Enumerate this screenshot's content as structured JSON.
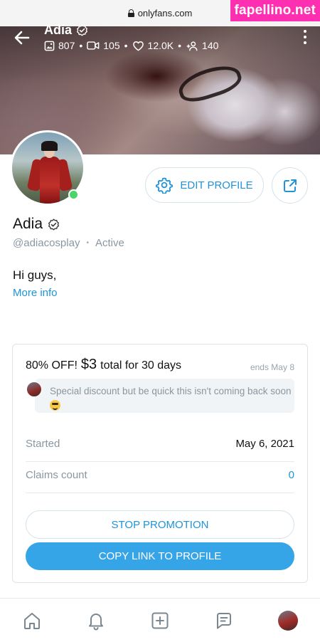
{
  "browser": {
    "url": "onlyfans.com"
  },
  "watermark": "fapellino.net",
  "header": {
    "name": "Adia",
    "stats": {
      "photos": "807",
      "videos": "105",
      "likes": "12.0K",
      "fans": "140"
    }
  },
  "profile": {
    "name": "Adia",
    "handle": "@adiacosplay",
    "status": "Active",
    "bio": "Hi guys,",
    "more_info": "More info",
    "online": true
  },
  "actions": {
    "edit_profile": "EDIT PROFILE"
  },
  "promotion": {
    "title_prefix": "80% OFF!",
    "price": "$3",
    "title_suffix": "total for 30 days",
    "ends": "ends May 8",
    "message": "Special discount but be quick this isn't coming back soon",
    "started_label": "Started",
    "started_value": "May 6, 2021",
    "claims_label": "Claims count",
    "claims_value": "0",
    "stop_button": "STOP PROMOTION",
    "copy_button": "COPY LINK TO PROFILE"
  },
  "colors": {
    "accent": "#1f93d8",
    "primary_button": "#35a5e8",
    "online": "#4cd36a",
    "watermark_bg": "#ff2fb1"
  },
  "nav": {
    "items": [
      "home-icon",
      "bell-icon",
      "plus-square-icon",
      "message-icon",
      "profile-avatar"
    ]
  }
}
